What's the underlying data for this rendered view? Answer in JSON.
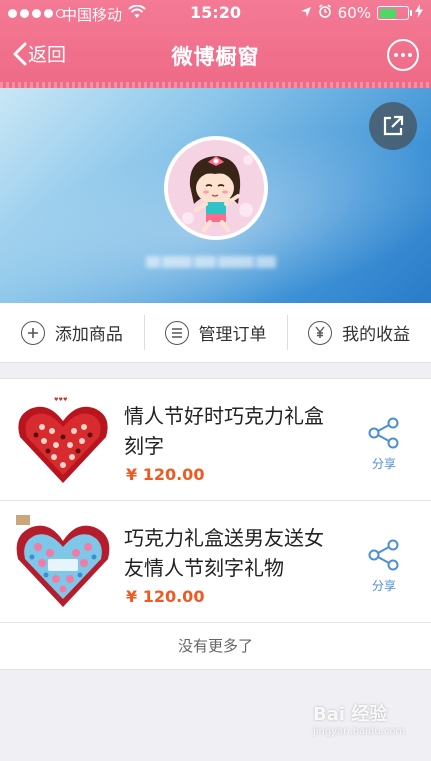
{
  "status_bar": {
    "carrier": "中国移动",
    "time": "15:20",
    "battery": "60%",
    "battery_level": 0.6
  },
  "nav": {
    "back_label": "返回",
    "title": "微博橱窗"
  },
  "actions": [
    {
      "label": "添加商品",
      "icon": "plus-circle-icon"
    },
    {
      "label": "管理订单",
      "icon": "list-circle-icon"
    },
    {
      "label": "我的收益",
      "icon": "yen-circle-icon"
    }
  ],
  "products": [
    {
      "title": "情人节好时巧克力礼盒刻字",
      "price": "¥ 120.00",
      "share_label": "分享"
    },
    {
      "title": "巧克力礼盒送男友送女友情人节刻字礼物",
      "price": "¥ 120.00",
      "share_label": "分享"
    }
  ],
  "list_footer": "没有更多了",
  "watermark": {
    "top": "Bai 经验",
    "bottom": "jingyan.baidu.com"
  },
  "colors": {
    "nav_pink": "#ee6a86",
    "price_orange": "#f05a22",
    "share_blue": "#4a8fd8"
  }
}
